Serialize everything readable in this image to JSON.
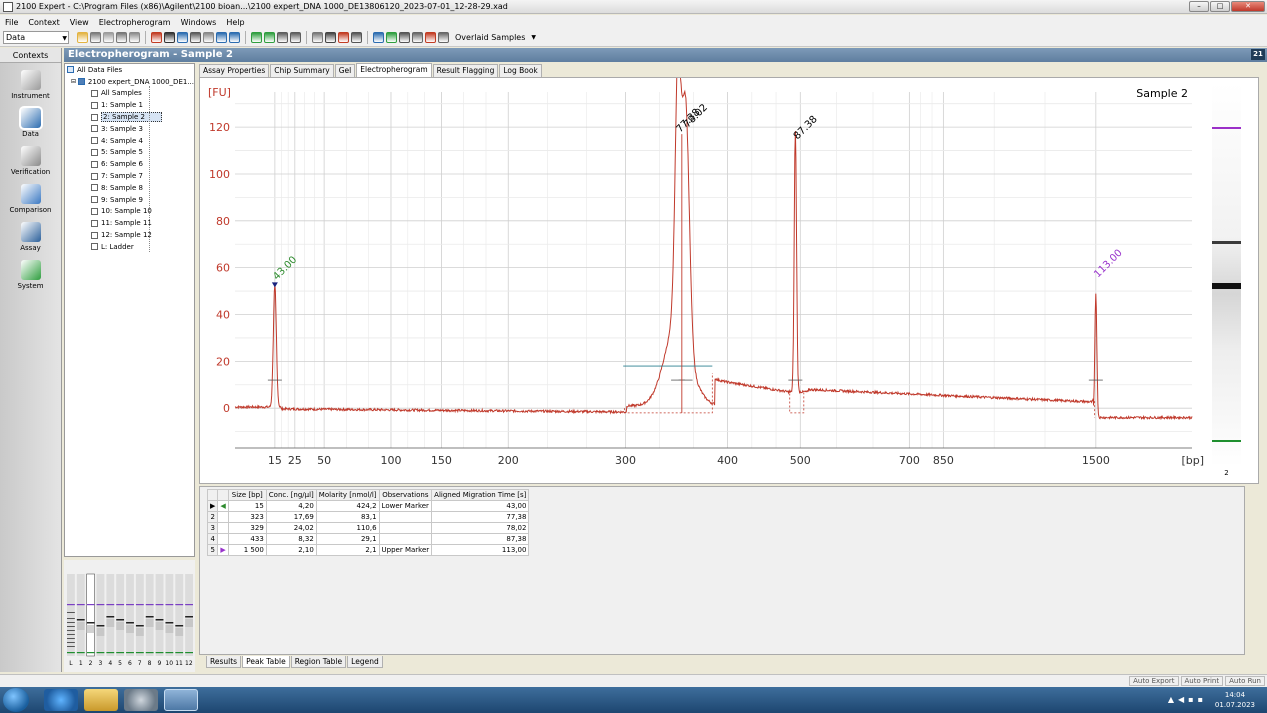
{
  "window": {
    "title": "2100 Expert - C:\\Program Files (x86)\\Agilent\\2100 bioan...\\2100 expert_DNA 1000_DE13806120_2023-07-01_12-28-29.xad",
    "min_label": "–",
    "max_label": "□",
    "close_label": "✕"
  },
  "menu": [
    "File",
    "Context",
    "View",
    "Electropherogram",
    "Windows",
    "Help"
  ],
  "toolbar": {
    "context_value": "Data",
    "overlaid_label": "Overlaid Samples"
  },
  "contexts": {
    "header": "Contexts",
    "items": [
      {
        "label": "Instrument",
        "color": "#9a9a9a"
      },
      {
        "label": "Data",
        "color": "#2b6cb0"
      },
      {
        "label": "Verification",
        "color": "#8a8a8a"
      },
      {
        "label": "Comparison",
        "color": "#3a78c2"
      },
      {
        "label": "Assay",
        "color": "#2a5f9a"
      },
      {
        "label": "System",
        "color": "#2e9e3e"
      }
    ]
  },
  "panel": {
    "title": "Electropherogram - Sample 2",
    "pin": "21"
  },
  "tree": {
    "root": "All Data Files",
    "file": "2100 expert_DNA 1000_DE1...",
    "items": [
      "All Samples",
      "1: Sample 1",
      "2: Sample 2",
      "3: Sample 3",
      "4: Sample 4",
      "5: Sample 5",
      "6: Sample 6",
      "7: Sample 7",
      "8: Sample 8",
      "9: Sample 9",
      "10: Sample 10",
      "11: Sample 11",
      "12: Sample 12",
      "L: Ladder"
    ],
    "selected_index": 2
  },
  "gel_thumb": {
    "labels": [
      "L",
      "1",
      "2",
      "3",
      "4",
      "5",
      "6",
      "7",
      "8",
      "9",
      "10",
      "11",
      "12"
    ]
  },
  "tabs_top": [
    "Assay Properties",
    "Chip Summary",
    "Gel",
    "Electropherogram",
    "Result Flagging",
    "Log Book"
  ],
  "tabs_top_active": 3,
  "chart_data": {
    "type": "line",
    "title": "Sample 2",
    "ylabel": "[FU]",
    "xlabel": "[bp]",
    "ylim": [
      -17,
      135
    ],
    "y_ticks": [
      0,
      20,
      40,
      60,
      80,
      100,
      120
    ],
    "x_ticks": [
      {
        "label": "15",
        "rt": 43.0
      },
      {
        "label": "25",
        "rt": 44.7
      },
      {
        "label": "50",
        "rt": 47.2
      },
      {
        "label": "100",
        "rt": 52.9
      },
      {
        "label": "150",
        "rt": 57.2
      },
      {
        "label": "200",
        "rt": 62.9
      },
      {
        "label": "300",
        "rt": 72.9
      },
      {
        "label": "400",
        "rt": 81.6
      },
      {
        "label": "500",
        "rt": 87.8
      },
      {
        "label": "700",
        "rt": 97.1
      },
      {
        "label": "850",
        "rt": 100.0
      },
      {
        "label": "1500",
        "rt": 113.0
      }
    ],
    "xlim_rt": [
      39.6,
      121.2
    ],
    "peaks": [
      {
        "rt": 43.0,
        "height": 52,
        "width": 0.18,
        "label": "43.00",
        "color": "#2e8b2e"
      },
      {
        "rt": 77.38,
        "height": 115,
        "width": 0.35,
        "label": "77.38",
        "color": "#000000"
      },
      {
        "rt": 78.02,
        "height": 117,
        "width": 0.45,
        "label": "78.02",
        "color": "#000000"
      },
      {
        "rt": 87.38,
        "height": 112,
        "width": 0.14,
        "label": "87.38",
        "color": "#000000"
      },
      {
        "rt": 113.0,
        "height": 53,
        "width": 0.12,
        "label": "113.00",
        "color": "#9933cc"
      }
    ],
    "line_color": "#c0392b",
    "grid": true
  },
  "gel_side": {
    "lane_label": "2"
  },
  "peak_table": {
    "headers": [
      "",
      "",
      "Size [bp]",
      "Conc. [ng/µl]",
      "Molarity [nmol/l]",
      "Observations",
      "Aligned Migration Time [s]"
    ],
    "rows": [
      [
        "▶",
        "◀",
        "15",
        "4,20",
        "424,2",
        "Lower Marker",
        "43,00"
      ],
      [
        "2",
        "",
        "323",
        "17,69",
        "83,1",
        "",
        "77,38"
      ],
      [
        "3",
        "",
        "329",
        "24,02",
        "110,6",
        "",
        "78,02"
      ],
      [
        "4",
        "",
        "433",
        "8,32",
        "29,1",
        "",
        "87,38"
      ],
      [
        "5",
        "▶",
        "1 500",
        "2,10",
        "2,1",
        "Upper Marker",
        "113,00"
      ]
    ]
  },
  "tabs_bottom": [
    "Results",
    "Peak Table",
    "Region Table",
    "Legend"
  ],
  "tabs_bottom_active": 1,
  "status": {
    "buttons": [
      "Auto Export",
      "Auto Print",
      "Auto Run"
    ]
  },
  "taskbar": {
    "time": "14:04",
    "date": "01.07.2023"
  }
}
